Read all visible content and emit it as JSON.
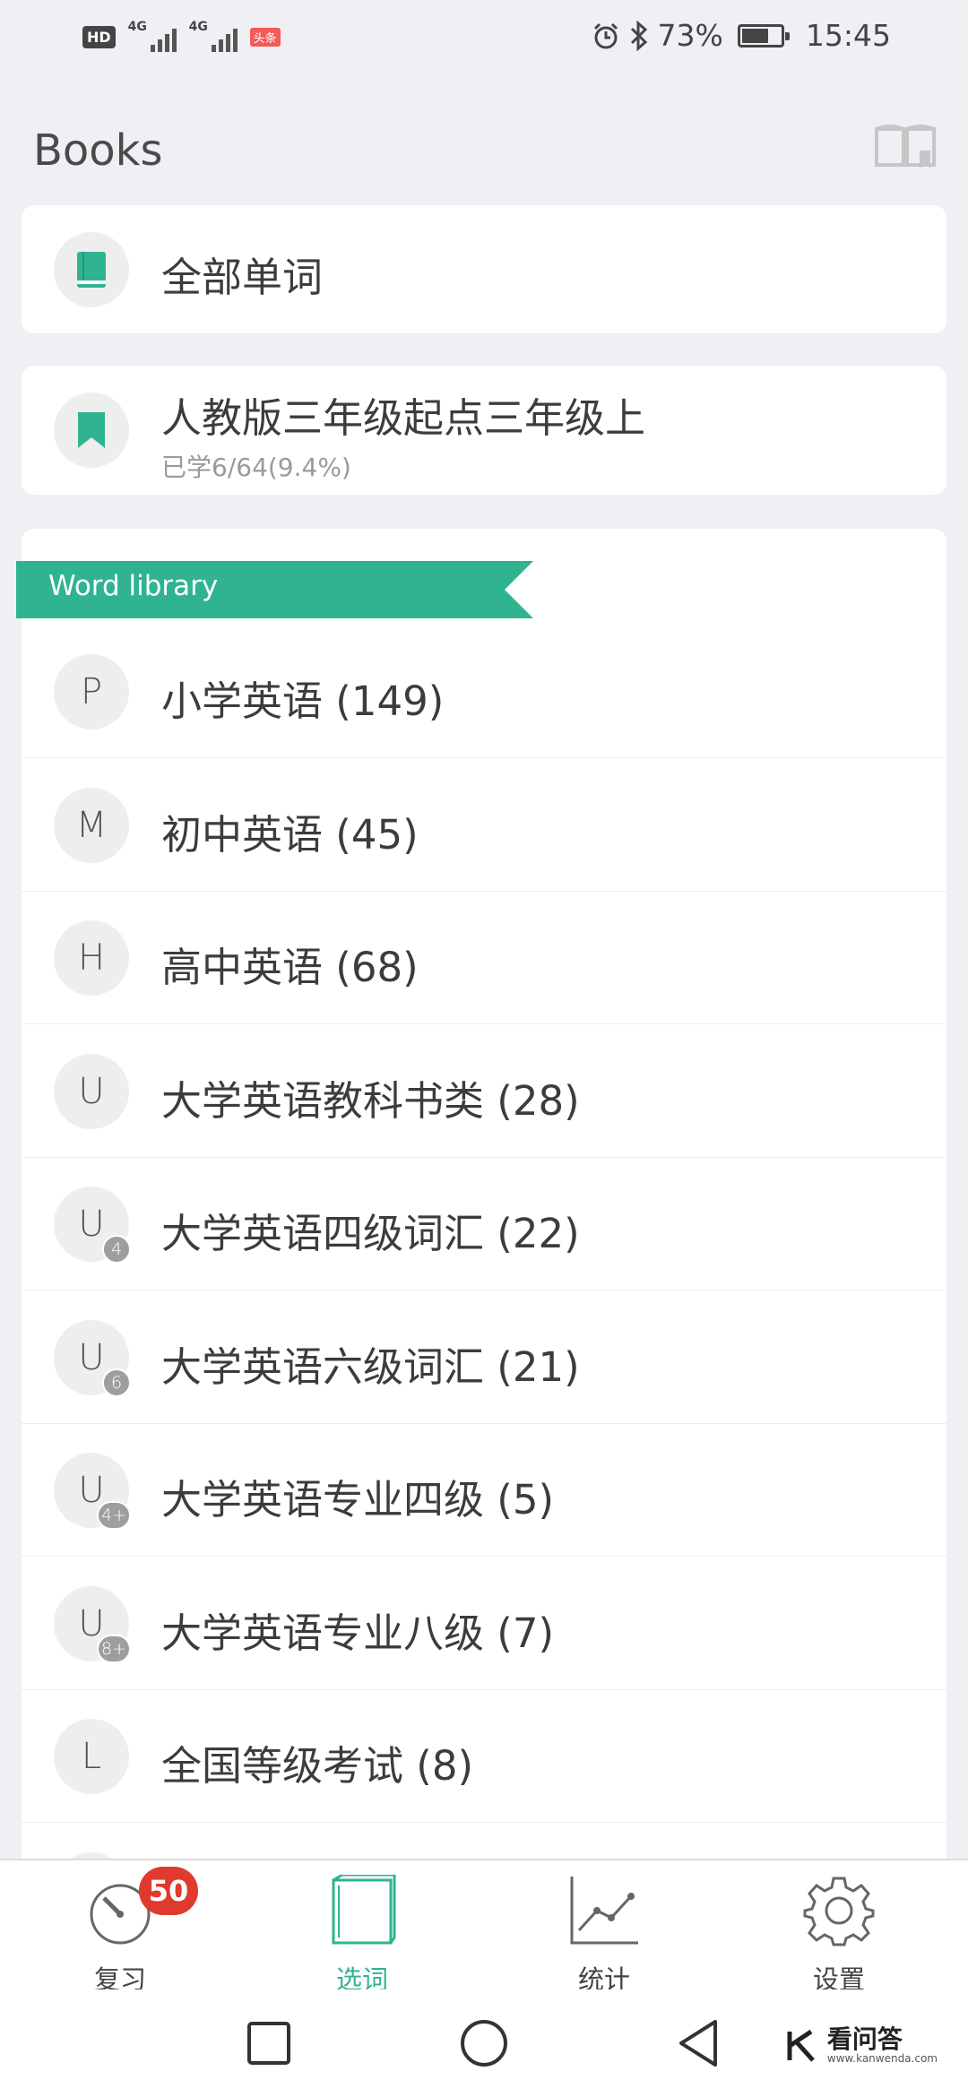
{
  "status_bar": {
    "hd": "HD",
    "network_1": "4G",
    "network_2": "4G",
    "app_badge": "头条",
    "battery_percent": "73%",
    "battery_level": 0.73,
    "time": "15:45",
    "icons": [
      "alarm-icon",
      "bluetooth-icon",
      "battery-icon"
    ]
  },
  "header": {
    "title": "Books",
    "action_icon": "book-icon"
  },
  "all_words": {
    "label": "全部单词",
    "icon": "book-icon"
  },
  "current_book": {
    "title": "人教版三年级起点三年级上",
    "progress_text": "已学6/64(9.4%)",
    "icon": "bookmark-icon"
  },
  "library": {
    "ribbon_label": "Word library",
    "items": [
      {
        "letter": "P",
        "badge": "",
        "label": "小学英语 (149)"
      },
      {
        "letter": "M",
        "badge": "",
        "label": "初中英语 (45)"
      },
      {
        "letter": "H",
        "badge": "",
        "label": "高中英语 (68)"
      },
      {
        "letter": "U",
        "badge": "",
        "label": "大学英语教科书类 (28)"
      },
      {
        "letter": "U",
        "badge": "4",
        "label": "大学英语四级词汇 (22)"
      },
      {
        "letter": "U",
        "badge": "6",
        "label": "大学英语六级词汇 (21)"
      },
      {
        "letter": "U",
        "badge": "4+",
        "label": "大学英语专业四级 (5)"
      },
      {
        "letter": "U",
        "badge": "8+",
        "label": "大学英语专业八级 (7)"
      },
      {
        "letter": "L",
        "badge": "",
        "label": "全国等级考试 (8)"
      }
    ]
  },
  "tabs": [
    {
      "label": "复习",
      "icon": "stopwatch-icon",
      "badge": "50",
      "active": false
    },
    {
      "label": "选词",
      "icon": "book-select-icon",
      "active": true
    },
    {
      "label": "统计",
      "icon": "line-chart-icon",
      "active": false
    },
    {
      "label": "设置",
      "icon": "gear-icon",
      "active": false
    }
  ],
  "colors": {
    "accent": "#2fb391",
    "badge_red": "#e0392e",
    "background": "#efeff4"
  },
  "watermark": {
    "text": "看问答",
    "sub": "www.kanwenda.com"
  }
}
